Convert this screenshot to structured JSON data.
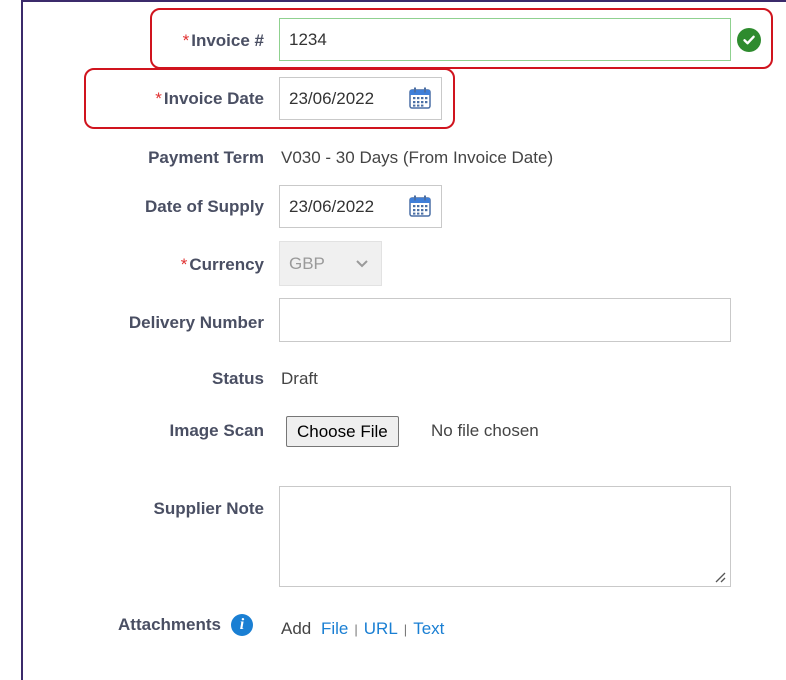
{
  "form": {
    "required_mark": "*",
    "invoice_number": {
      "label": "Invoice #",
      "value": "1234",
      "valid": true
    },
    "invoice_date": {
      "label": "Invoice Date",
      "value": "23/06/2022"
    },
    "payment_term": {
      "label": "Payment Term",
      "value": "V030 - 30 Days (From Invoice Date)"
    },
    "date_of_supply": {
      "label": "Date of Supply",
      "value": "23/06/2022"
    },
    "currency": {
      "label": "Currency",
      "selected": "GBP"
    },
    "delivery_number": {
      "label": "Delivery Number",
      "value": ""
    },
    "status": {
      "label": "Status",
      "value": "Draft"
    },
    "image_scan": {
      "label": "Image Scan",
      "button_label": "Choose File",
      "file_status": "No file chosen"
    },
    "supplier_note": {
      "label": "Supplier Note",
      "value": ""
    },
    "attachments": {
      "label": "Attachments",
      "add_label": "Add",
      "links": [
        "File",
        "URL",
        "Text"
      ],
      "separator": "|"
    }
  },
  "colors": {
    "required": "#e03131",
    "label": "#4a4f63",
    "link": "#1a7fd3",
    "valid_badge": "#2e8b2e",
    "highlight": "#d0141e",
    "frame": "#3b2a6b"
  },
  "icons": {
    "valid": "check-circle-icon",
    "calendar": "calendar-icon",
    "select": "chevron-down-icon",
    "info": "info-icon",
    "resize": "resize-grip-icon"
  }
}
